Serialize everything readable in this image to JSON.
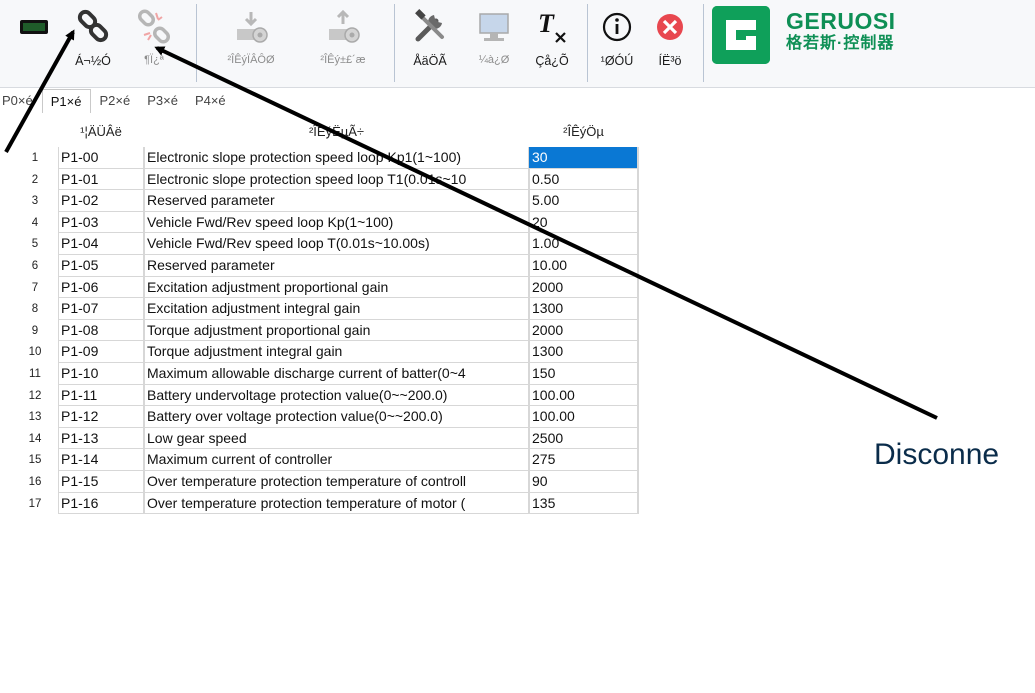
{
  "toolbar": {
    "buttons": [
      {
        "id": "connect",
        "label": "Á¬½Ó"
      },
      {
        "id": "disconnect",
        "label": "¶Ï¿ª"
      },
      {
        "id": "read-param",
        "label": "²ÎÊýÏÂÔØ"
      },
      {
        "id": "save-param",
        "label": "²ÎÊý±£´æ"
      },
      {
        "id": "config",
        "label": "ÅäÖÃ"
      },
      {
        "id": "monitor",
        "label": "¼à¿Ø"
      },
      {
        "id": "clear",
        "label": "Çå¿Õ"
      },
      {
        "id": "about",
        "label": "¹ØÓÚ"
      },
      {
        "id": "exit",
        "label": "ÍË³ö"
      }
    ]
  },
  "logo": {
    "en": "GERUOSI",
    "cn": "格若斯·控制器"
  },
  "tabs": [
    {
      "label": "P0×é",
      "active": false
    },
    {
      "label": "P1×é",
      "active": true
    },
    {
      "label": "P2×é",
      "active": false
    },
    {
      "label": "P3×é",
      "active": false
    },
    {
      "label": "P4×é",
      "active": false
    }
  ],
  "table": {
    "headers": {
      "code": "¹¦ÄÜÂë",
      "desc": "²ÎÊýËµÃ÷",
      "value": "²ÎÊýÖµ"
    },
    "rows": [
      {
        "n": "1",
        "code": "P1-00",
        "desc": "Electronic slope protection speed loop Kp1(1~100)",
        "value": "30"
      },
      {
        "n": "2",
        "code": "P1-01",
        "desc": "Electronic slope protection speed loop T1(0.01s~10",
        "value": "0.50"
      },
      {
        "n": "3",
        "code": "P1-02",
        "desc": "Reserved parameter",
        "value": "5.00"
      },
      {
        "n": "4",
        "code": "P1-03",
        "desc": "Vehicle Fwd/Rev  speed loop Kp(1~100)",
        "value": "20"
      },
      {
        "n": "5",
        "code": "P1-04",
        "desc": "Vehicle Fwd/Rev  speed loop T(0.01s~10.00s)",
        "value": "1.00"
      },
      {
        "n": "6",
        "code": "P1-05",
        "desc": "Reserved parameter",
        "value": "10.00"
      },
      {
        "n": "7",
        "code": "P1-06",
        "desc": "Excitation adjustment proportional gain",
        "value": "2000"
      },
      {
        "n": "8",
        "code": "P1-07",
        "desc": "Excitation adjustment integral gain",
        "value": "1300"
      },
      {
        "n": "9",
        "code": "P1-08",
        "desc": "Torque adjustment proportional gain",
        "value": "2000"
      },
      {
        "n": "10",
        "code": "P1-09",
        "desc": "Torque adjustment integral gain",
        "value": "1300"
      },
      {
        "n": "11",
        "code": "P1-10",
        "desc": "Maximum allowable discharge current of batter(0~4",
        "value": "150"
      },
      {
        "n": "12",
        "code": "P1-11",
        "desc": "Battery undervoltage protection value(0~~200.0)",
        "value": "100.00"
      },
      {
        "n": "13",
        "code": "P1-12",
        "desc": "Battery over voltage protection value(0~~200.0)",
        "value": "100.00"
      },
      {
        "n": "14",
        "code": "P1-13",
        "desc": "Low gear speed",
        "value": "2500"
      },
      {
        "n": "15",
        "code": "P1-14",
        "desc": "Maximum current of controller",
        "value": "275"
      },
      {
        "n": "16",
        "code": "P1-15",
        "desc": "Over temperature protection temperature of controll",
        "value": "90"
      },
      {
        "n": "17",
        "code": "P1-16",
        "desc": "Over temperature protection temperature of motor (",
        "value": "135"
      }
    ]
  },
  "annotation": {
    "text": "Disconne"
  },
  "colors": {
    "selection": "#0a78d4",
    "brand": "#0e8f55",
    "close": "#e8474f"
  }
}
